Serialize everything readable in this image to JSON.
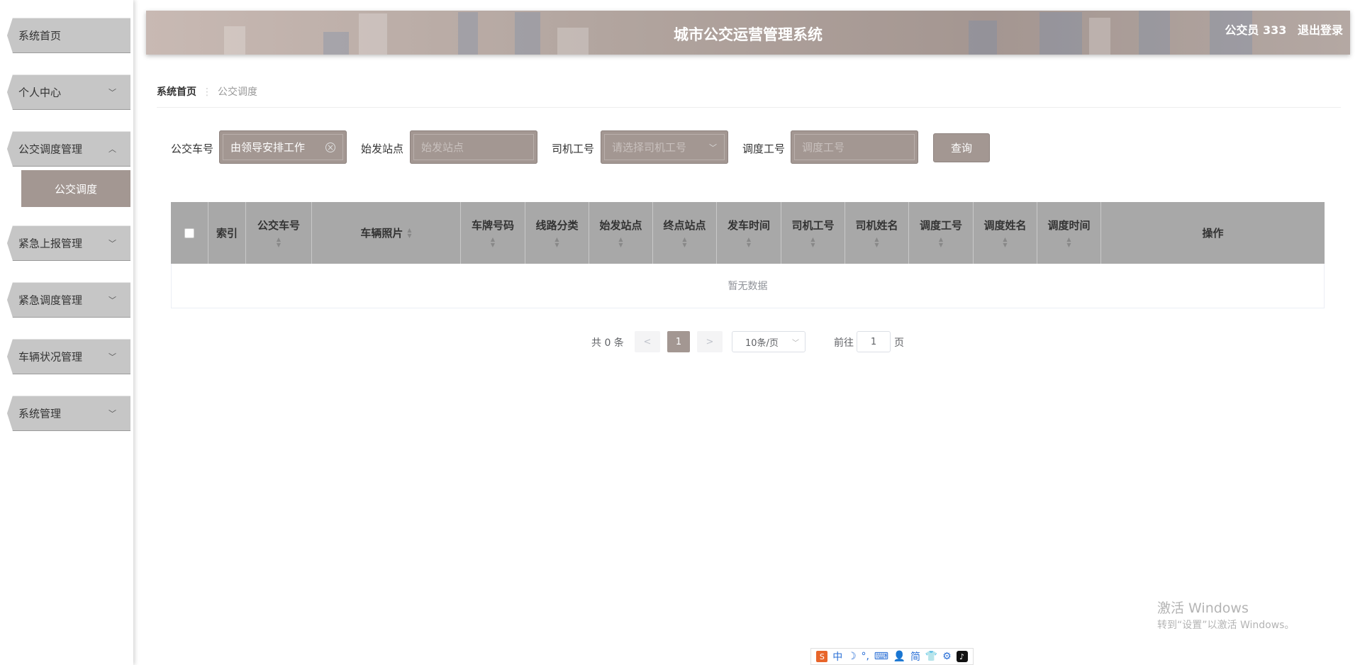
{
  "sidebar": {
    "items": [
      {
        "label": "系统首页",
        "arrow": ""
      },
      {
        "label": "个人中心",
        "arrow": "﹀"
      },
      {
        "label": "公交调度管理",
        "arrow": "︿"
      },
      {
        "label": "紧急上报管理",
        "arrow": "﹀"
      },
      {
        "label": "紧急调度管理",
        "arrow": "﹀"
      },
      {
        "label": "车辆状况管理",
        "arrow": "﹀"
      },
      {
        "label": "系统管理",
        "arrow": "﹀"
      }
    ],
    "submenu": {
      "label": "公交调度"
    }
  },
  "header": {
    "title": "城市公交运营管理系统",
    "user": "公交员 333",
    "logout": "退出登录"
  },
  "breadcrumb": {
    "home": "系统首页",
    "separator": "⋮",
    "current": "公交调度"
  },
  "search": {
    "bus_no_label": "公交车号",
    "bus_no_value": "由领导安排工作",
    "start_label": "始发站点",
    "start_placeholder": "始发站点",
    "driver_label": "司机工号",
    "driver_placeholder": "请选择司机工号",
    "dispatch_label": "调度工号",
    "dispatch_placeholder": "调度工号",
    "query_button": "查询"
  },
  "table": {
    "headers": [
      "索引",
      "公交车号",
      "车辆照片",
      "车牌号码",
      "线路分类",
      "始发站点",
      "终点站点",
      "发车时间",
      "司机工号",
      "司机姓名",
      "调度工号",
      "调度姓名",
      "调度时间",
      "操作"
    ],
    "empty_text": "暂无数据"
  },
  "pagination": {
    "total": "共 0 条",
    "prev": "<",
    "page": "1",
    "next": ">",
    "page_size": "10条/页",
    "goto_label": "前往",
    "goto_value": "1",
    "page_suffix": "页"
  },
  "watermark": {
    "line1": "激活 Windows",
    "line2": "转到“设置”以激活 Windows。"
  },
  "ime": {
    "items": [
      "中",
      "☽",
      "°,",
      "⌨",
      "👤",
      "简",
      "👕",
      "⚙"
    ]
  },
  "colors": {
    "accent": "#a39792",
    "sidebar_item": "#c6c6c6",
    "table_header": "#a8a8a8"
  }
}
